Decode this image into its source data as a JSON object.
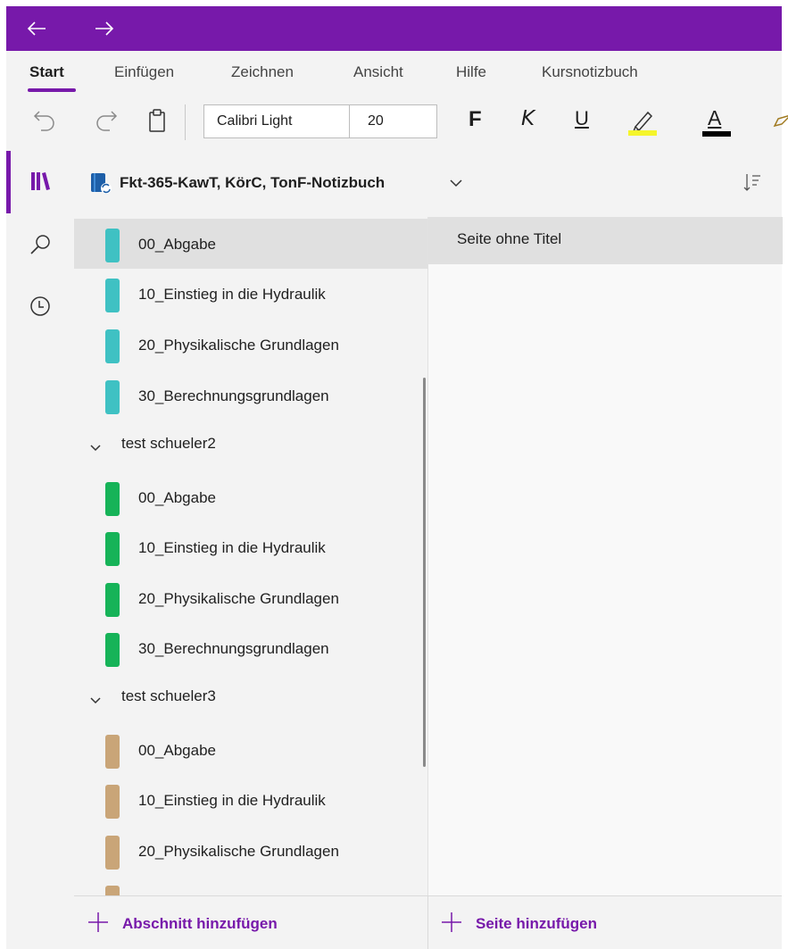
{
  "titlebar": {
    "back_icon": "arrow-left-icon",
    "forward_icon": "arrow-right-icon",
    "color": "#7719aa"
  },
  "ribbon": {
    "tabs": [
      {
        "label": "Start",
        "active": true
      },
      {
        "label": "Einfügen",
        "active": false
      },
      {
        "label": "Zeichnen",
        "active": false
      },
      {
        "label": "Ansicht",
        "active": false
      },
      {
        "label": "Hilfe",
        "active": false
      },
      {
        "label": "Kursnotizbuch",
        "active": false
      }
    ]
  },
  "toolbar": {
    "font_name": "Calibri Light",
    "font_size": "20",
    "bold_label": "F",
    "italic_label": "K",
    "underline_label": "U",
    "font_color_label": "A",
    "highlight_color": "#f5f52b",
    "font_color": "#000000"
  },
  "notebook": {
    "name": "Fkt-365-KawT, KörC, TonF-Notizbuch"
  },
  "sections": {
    "top_group": [
      {
        "label": "00_Abgabe",
        "color": "#3fc1c3",
        "selected": true
      },
      {
        "label": "10_Einstieg in die Hydraulik",
        "color": "#3fc1c3",
        "selected": false
      },
      {
        "label": "20_Physikalische Grundlagen",
        "color": "#3fc1c3",
        "selected": false
      },
      {
        "label": "30_Berechnungsgrundlagen",
        "color": "#3fc1c3",
        "selected": false
      }
    ],
    "group2": {
      "label": "test schueler2",
      "items": [
        {
          "label": "00_Abgabe",
          "color": "#16b358"
        },
        {
          "label": "10_Einstieg in die Hydraulik",
          "color": "#16b358"
        },
        {
          "label": "20_Physikalische Grundlagen",
          "color": "#16b358"
        },
        {
          "label": "30_Berechnungsgrundlagen",
          "color": "#16b358"
        }
      ]
    },
    "group3": {
      "label": "test schueler3",
      "items": [
        {
          "label": "00_Abgabe",
          "color": "#c9a578"
        },
        {
          "label": "10_Einstieg in die Hydraulik",
          "color": "#c9a578"
        },
        {
          "label": "20_Physikalische Grundlagen",
          "color": "#c9a578"
        }
      ]
    }
  },
  "pages": {
    "items": [
      {
        "label": "Seite ohne Titel",
        "selected": true
      }
    ]
  },
  "bottom": {
    "add_section_label": "Abschnitt hinzufügen",
    "add_page_label": "Seite hinzufügen",
    "accent": "#7719aa"
  }
}
